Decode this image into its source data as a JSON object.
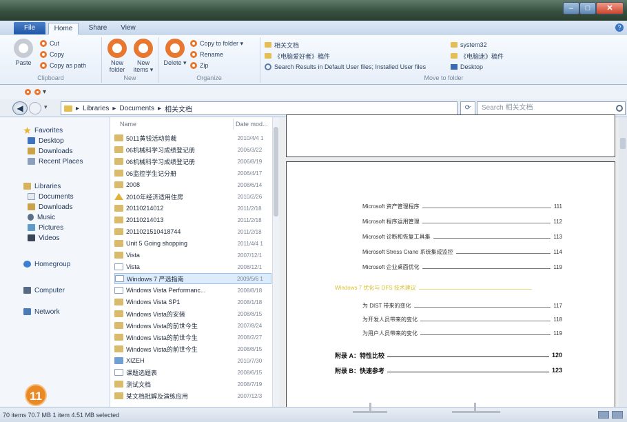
{
  "window": {
    "title": "",
    "buttons": {
      "minimize": "–",
      "maximize": "□",
      "close": "✕"
    }
  },
  "ribbon_tabs": {
    "file": "File",
    "tabs": [
      "Home",
      "Share",
      "View"
    ],
    "active": "Home",
    "help": "?"
  },
  "ribbon": {
    "clipboard": {
      "label": "Clipboard",
      "paste": "Paste",
      "cut": "Cut",
      "copy": "Copy",
      "copy_as_path": "Copy as path"
    },
    "new": {
      "label": "New",
      "new_folder": "New folder",
      "new_items": "New items ▾"
    },
    "organize": {
      "label": "Organize",
      "delete": "Delete ▾",
      "copy_to_folder": "Copy to folder ▾",
      "rename": "Rename",
      "zip": "Zip"
    },
    "move_to_folder": {
      "label": "Move to folder",
      "items": [
        "相关文档",
        "《电脑爱好者》稿件",
        "Search Results in Default User files; Installed User files",
        "system32",
        "《电脑迷》稿件",
        "Desktop"
      ]
    }
  },
  "address": {
    "path": [
      "Libraries",
      "Documents",
      "相关文档"
    ],
    "search_placeholder": "Search 相关文档"
  },
  "navigation": {
    "favorites": "Favorites",
    "favorite_items": [
      "Desktop",
      "Downloads",
      "Recent Places"
    ],
    "libraries": "Libraries",
    "library_items": [
      "Documents",
      "Downloads",
      "Music",
      "Pictures",
      "Videos"
    ],
    "homegroup": "Homegroup",
    "computer": "Computer",
    "network": "Network"
  },
  "file_list": {
    "columns": {
      "name": "Name",
      "date": "Date mod..."
    },
    "rows": [
      {
        "name": "5011黄钱活动剪裁",
        "date": "2010/4/4 1",
        "icon": "folder"
      },
      {
        "name": "06机械科学习成绩登记册",
        "date": "2006/3/22",
        "icon": "folder"
      },
      {
        "name": "06机械科学习成绩登记册",
        "date": "2006/8/19",
        "icon": "folder"
      },
      {
        "name": "06监控学生记分册",
        "date": "2006/4/17",
        "icon": "folder"
      },
      {
        "name": "2008",
        "date": "2008/6/14",
        "icon": "folder"
      },
      {
        "name": "2010年经济适用住房",
        "date": "2010/2/26",
        "icon": "pdf"
      },
      {
        "name": "20110214012",
        "date": "2011/2/18",
        "icon": "folder"
      },
      {
        "name": "20110214013",
        "date": "2011/2/18",
        "icon": "folder"
      },
      {
        "name": "2011021510418744",
        "date": "2011/2/18",
        "icon": "folder"
      },
      {
        "name": "Unit 5 Going shopping",
        "date": "2011/4/4 1",
        "icon": "folder"
      },
      {
        "name": "Vista",
        "date": "2007/12/1",
        "icon": "folder"
      },
      {
        "name": "Vista",
        "date": "2008/12/1",
        "icon": "doc"
      },
      {
        "name": "Windows 7 严选指南",
        "date": "2009/5/6 1",
        "icon": "doc"
      },
      {
        "name": "Windows Vista Performanc...",
        "date": "2008/8/18",
        "icon": "doc"
      },
      {
        "name": "Windows Vista SP1",
        "date": "2008/1/18",
        "icon": "folder"
      },
      {
        "name": "Windows Vista的安装",
        "date": "2008/8/15",
        "icon": "folder"
      },
      {
        "name": "Windows Vista的前世今生",
        "date": "2007/8/24",
        "icon": "folder"
      },
      {
        "name": "Windows Vista的前世今生",
        "date": "2008/2/27",
        "icon": "folder"
      },
      {
        "name": "Windows Vista的前世今生",
        "date": "2008/8/15",
        "icon": "folder"
      },
      {
        "name": "XIZEH",
        "date": "2010/7/30",
        "icon": "vid"
      },
      {
        "name": "课题选题表",
        "date": "2008/6/15",
        "icon": "doc"
      },
      {
        "name": "测试文档",
        "date": "2008/7/19",
        "icon": "folder"
      },
      {
        "name": "某文档批解及演练应用",
        "date": "2007/12/3",
        "icon": "folder"
      }
    ],
    "selected_index": 12
  },
  "preview": {
    "toc": [
      {
        "text": "Microsoft 资产管理程序",
        "page": "111",
        "kind": "entry"
      },
      {
        "text": "Microsoft 程序运用管理",
        "page": "112",
        "kind": "entry"
      },
      {
        "text": "Microsoft 诊断和恢复工具集",
        "page": "113",
        "kind": "entry"
      },
      {
        "text": "Microsoft Stress Crane 系统集成监控",
        "page": "114",
        "kind": "entry"
      },
      {
        "text": "Microsoft 企业桌面优化",
        "page": "119",
        "kind": "entry"
      },
      {
        "text": "Windows 7 优化与 DFS 技术建议",
        "page": "",
        "kind": "highlight"
      },
      {
        "text": "为 DIST 带来的变化",
        "page": "117",
        "kind": "sub"
      },
      {
        "text": "为开发人员带来的变化",
        "page": "118",
        "kind": "sub"
      },
      {
        "text": "为用户人员带来的变化",
        "page": "119",
        "kind": "sub"
      },
      {
        "text": "附录 A：特性比较",
        "page": "120",
        "kind": "chapter"
      },
      {
        "text": "附录 B：快速参考",
        "page": "123",
        "kind": "chapter"
      }
    ]
  },
  "status": {
    "text": "70 items 70.7 MB   1 item 4.51 MB selected"
  },
  "step_badge": "11",
  "colors": {
    "accent": "#e8772f",
    "selection": "#dcecfc",
    "badge": "#e98a26"
  }
}
